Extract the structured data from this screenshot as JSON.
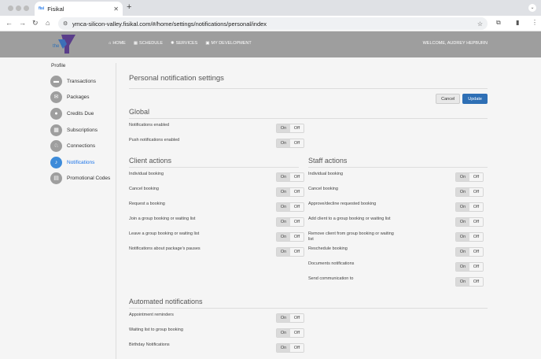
{
  "browser": {
    "tab_favicon": "fisi",
    "tab_title": "Fisikal",
    "url": "ymca-silicon-valley.fisikal.com/#/home/settings/notifications/personal/index"
  },
  "header": {
    "logo_text": "the Y",
    "menu": [
      {
        "icon": "home-icon",
        "label": "HOME"
      },
      {
        "icon": "calendar-icon",
        "label": "SCHEDULE"
      },
      {
        "icon": "services-icon",
        "label": "SERVICES"
      },
      {
        "icon": "briefcase-icon",
        "label": "MY DEVELOPMENT"
      }
    ],
    "welcome": "WELCOME, AUDREY HEPBURN"
  },
  "sidebar": {
    "title": "Profile",
    "items": [
      {
        "label": "Transactions",
        "icon": "transactions-icon",
        "active": false
      },
      {
        "label": "Packages",
        "icon": "packages-icon",
        "active": false
      },
      {
        "label": "Credits Due",
        "icon": "credits-icon",
        "active": false
      },
      {
        "label": "Subscriptions",
        "icon": "subscriptions-icon",
        "active": false
      },
      {
        "label": "Connections",
        "icon": "connections-icon",
        "active": false
      },
      {
        "label": "Notifications",
        "icon": "bell-icon",
        "active": true
      },
      {
        "label": "Promotional Codes",
        "icon": "promo-icon",
        "active": false
      }
    ]
  },
  "main": {
    "page_title": "Personal notification settings",
    "cancel_label": "Cancel",
    "update_label": "Update",
    "toggle_on": "On",
    "toggle_off": "Off",
    "global": {
      "title": "Global",
      "rows": [
        {
          "label": "Notifications enabled",
          "value": "on"
        },
        {
          "label": "Push notifications enabled",
          "value": "on"
        }
      ]
    },
    "client": {
      "title": "Client actions",
      "rows": [
        {
          "label": "Individual booking",
          "value": "on"
        },
        {
          "label": "Cancel booking",
          "value": "on"
        },
        {
          "label": "Request a booking",
          "value": "on"
        },
        {
          "label": "Join a group booking or waiting list",
          "value": "on"
        },
        {
          "label": "Leave a group booking or waiting list",
          "value": "on"
        },
        {
          "label": "Notifications about package's pauses",
          "value": "on"
        }
      ]
    },
    "staff": {
      "title": "Staff actions",
      "rows": [
        {
          "label": "Individual booking",
          "value": "on"
        },
        {
          "label": "Cancel booking",
          "value": "on"
        },
        {
          "label": "Approve/decline requested booking",
          "value": "on"
        },
        {
          "label": "Add client to a group booking or waiting list",
          "value": "on"
        },
        {
          "label": "Remove client from group booking or waiting list",
          "value": "on"
        },
        {
          "label": "Reschedule booking",
          "value": "on"
        },
        {
          "label": "Documents notifications",
          "value": "on"
        },
        {
          "label": "Send communication to",
          "value": "on"
        }
      ]
    },
    "automated": {
      "title": "Automated notifications",
      "rows": [
        {
          "label": "Appointment reminders",
          "value": "on"
        },
        {
          "label": "Waiting list to group booking",
          "value": "on"
        },
        {
          "label": "Birthday Notifications",
          "value": "on"
        }
      ]
    }
  }
}
